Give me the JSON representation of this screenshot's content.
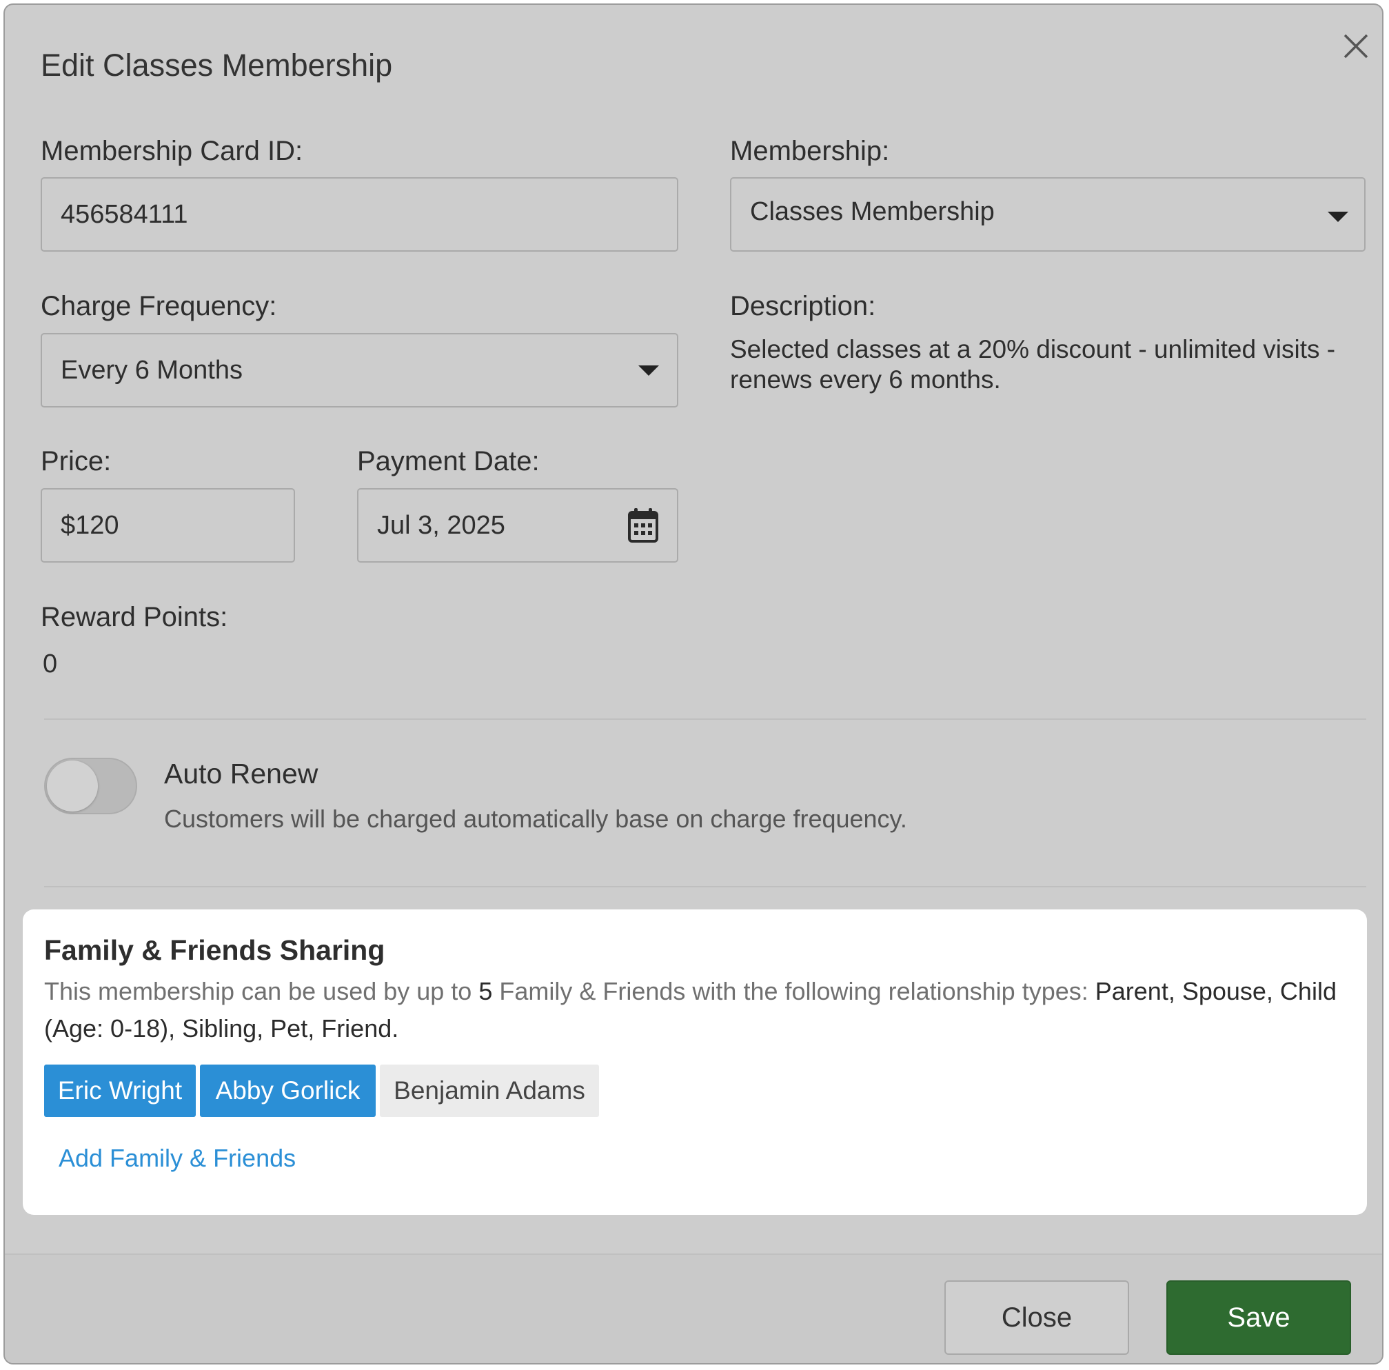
{
  "dialog": {
    "title": "Edit Classes Membership"
  },
  "form": {
    "card_id_label": "Membership Card ID:",
    "card_id_value": "456584111",
    "membership_label": "Membership:",
    "membership_value": "Classes Membership",
    "frequency_label": "Charge Frequency:",
    "frequency_value": "Every 6 Months",
    "description_label": "Description:",
    "description_text": "Selected classes at a 20% discount - unlimited visits - renews every 6 months.",
    "price_label": "Price:",
    "price_value": "$120",
    "payment_date_label": "Payment Date:",
    "payment_date_value": "Jul 3, 2025",
    "reward_label": "Reward Points:",
    "reward_value": "0"
  },
  "auto_renew": {
    "title": "Auto Renew",
    "help": "Customers will be charged automatically base on charge frequency.",
    "enabled": false
  },
  "sharing": {
    "title": "Family & Friends Sharing",
    "text_prefix": "This membership can be used by up to ",
    "limit": "5",
    "text_middle": " Family & Friends with the following relationship types: ",
    "types": "Parent, Spouse, Child (Age: 0-18), Sibling, Pet, Friend.",
    "members": [
      {
        "name": "Eric Wright",
        "selected": true
      },
      {
        "name": "Abby Gorlick",
        "selected": true
      },
      {
        "name": "Benjamin Adams",
        "selected": false
      }
    ],
    "add_link": "Add Family & Friends"
  },
  "footer": {
    "close_label": "Close",
    "save_label": "Save"
  },
  "colors": {
    "overlay_bg": "#cdcdcd",
    "accent_blue": "#2b8fd6",
    "save_green": "#2e6b30"
  },
  "icons": [
    "close-icon",
    "chevron-down-icon",
    "calendar-icon"
  ]
}
